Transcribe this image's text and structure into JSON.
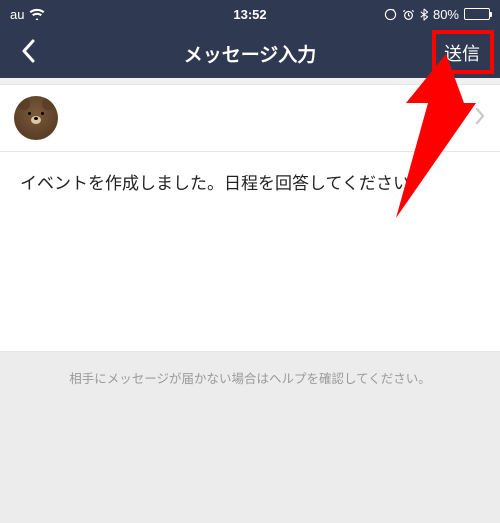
{
  "status": {
    "carrier": "au",
    "time": "13:52",
    "battery_percent": "80%"
  },
  "nav": {
    "title": "メッセージ入力",
    "send_label": "送信"
  },
  "message": {
    "text": "イベントを作成しました。日程を回答してください。"
  },
  "helper": {
    "text": "相手にメッセージが届かない場合はヘルプを確認してください。"
  }
}
